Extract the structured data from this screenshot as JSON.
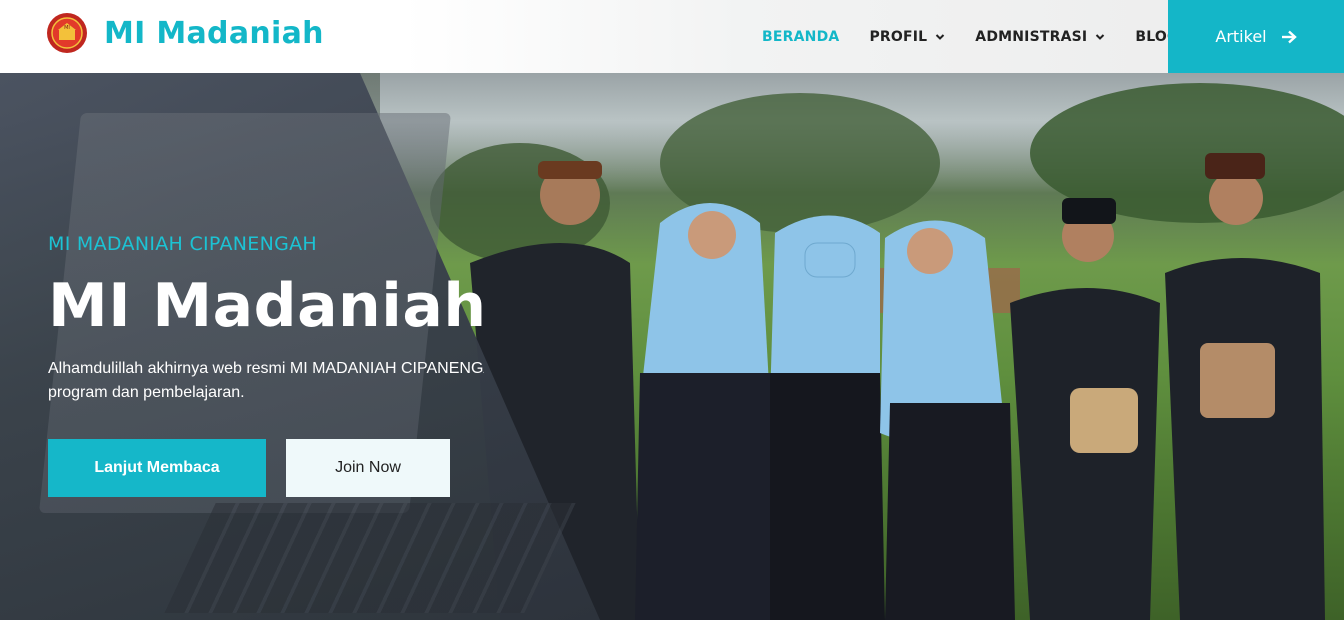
{
  "header": {
    "brand_name": "MI Madaniah",
    "logo_icon": "school-emblem-icon",
    "nav": [
      {
        "label": "BERANDA",
        "active": true,
        "dropdown": false
      },
      {
        "label": "PROFIL",
        "active": false,
        "dropdown": true
      },
      {
        "label": "ADMNISTRASI",
        "active": false,
        "dropdown": true
      },
      {
        "label": "BLOG",
        "active": false,
        "dropdown": false
      }
    ],
    "cta_label": "Artikel",
    "cta_icon": "arrow-right-icon"
  },
  "hero": {
    "eyebrow": "MI MADANIAH CIPANENGAH",
    "title": "MI Madaniah",
    "description_line1": "Alhamdulillah akhirnya web resmi MI MADANIAH CIPANENGAH",
    "description_line2": "program dan pembelajaran.",
    "primary_button": "Lanjut Membaca",
    "secondary_button": "Join Now"
  },
  "colors": {
    "accent": "#14b6c8",
    "nav_text": "#222222",
    "hero_text": "#ffffff",
    "secondary_button_bg": "#eff9fa"
  }
}
